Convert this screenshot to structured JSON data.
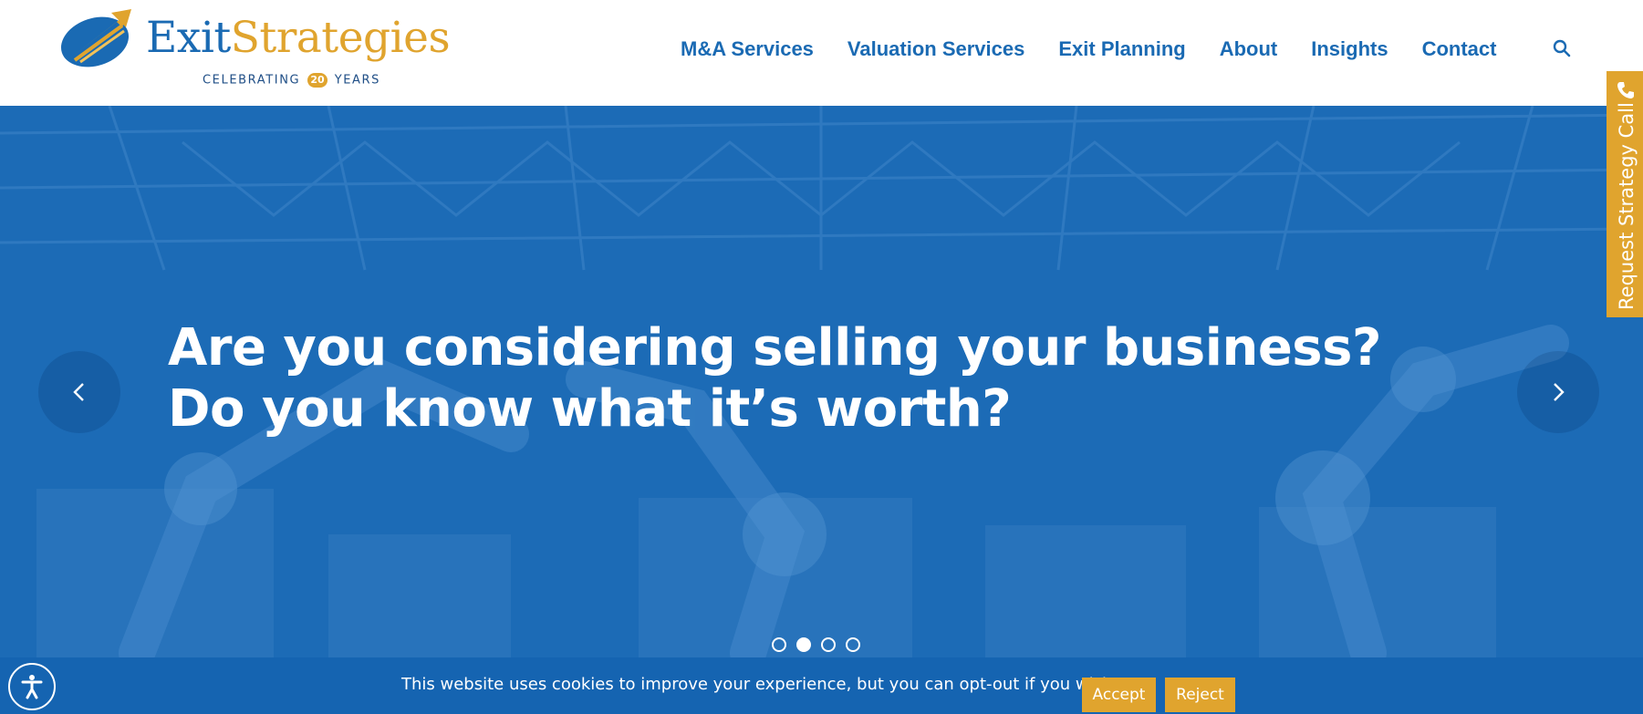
{
  "brand": {
    "name_part1": "Exit",
    "name_part2": "Strategies",
    "tagline_before": "CELEBRATING",
    "tagline_number": "20",
    "tagline_after": "YEARS"
  },
  "nav": {
    "items": [
      {
        "label": "M&A Services"
      },
      {
        "label": "Valuation Services"
      },
      {
        "label": "Exit Planning"
      },
      {
        "label": "About"
      },
      {
        "label": "Insights"
      },
      {
        "label": "Contact"
      }
    ],
    "search_icon": "search-icon"
  },
  "hero": {
    "line1": "Are you considering selling your business?",
    "line2": "Do you know what it’s worth?",
    "slide_count": 4,
    "active_slide": 2
  },
  "side_tab": {
    "label": "Request Strategy Call",
    "icon": "phone-icon"
  },
  "cookie": {
    "message": "This website uses cookies to improve your experience, but you can opt-out if you wish.",
    "accept_label": "Accept",
    "reject_label": "Reject"
  },
  "colors": {
    "brand_blue": "#1a6ab3",
    "brand_gold": "#e0a42e",
    "hero_blue": "#1d6bb6",
    "cookie_blue": "#1564b1"
  }
}
